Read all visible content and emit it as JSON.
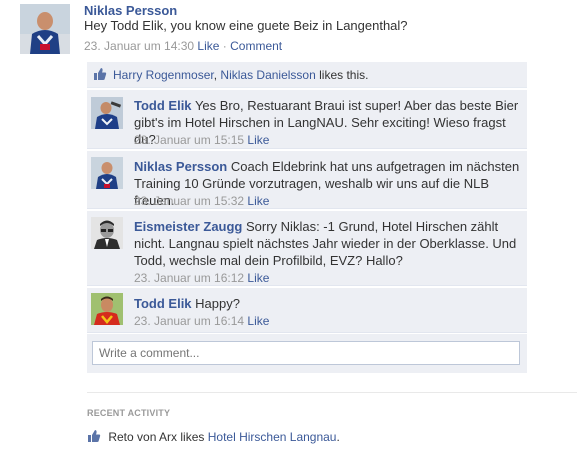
{
  "post": {
    "author": "Niklas Persson",
    "text": "Hey Todd Elik, you know eine guete Beiz in Langenthal?",
    "time": "23. Januar um 14:30",
    "like_label": "Like",
    "separator": "·",
    "comment_label": "Comment"
  },
  "likes": {
    "name1": "Harry Rogenmoser",
    "comma": ",",
    "name2": "Niklas Danielsson",
    "suffix": "likes this."
  },
  "comments": [
    {
      "author": "Todd Elik",
      "text": "Yes Bro, Restuarant Braui ist super! Aber das beste Bier gibt's im Hotel Hirschen in LangNAU. Sehr exciting! Wieso fragst du?",
      "time": "23. Januar um 15:15",
      "like": "Like"
    },
    {
      "author": "Niklas Persson",
      "text": "Coach Eldebrink hat uns aufgetragen im nächsten Training 10 Gründe vorzutragen, weshalb wir uns auf die NLB freuen.",
      "time": "23. Januar um 15:32",
      "like": "Like"
    },
    {
      "author": "Eismeister Zaugg",
      "text": "Sorry Niklas: -1 Grund, Hotel Hirschen zählt nicht. Langnau spielt nächstes Jahr wieder in der Oberklasse. Und Todd, wechsle mal dein Profilbild, EVZ? Hallo?",
      "time": "23. Januar um 16:12",
      "like": "Like"
    },
    {
      "author": "Todd Elik",
      "text": "Happy?",
      "time": "23. Januar um 16:14",
      "like": "Like"
    }
  ],
  "comment_input": {
    "placeholder": "Write a comment..."
  },
  "recent": {
    "title": "RECENT ACTIVITY",
    "actor": "Reto von Arx likes",
    "page": "Hotel Hirschen Langnau",
    "period": "."
  },
  "colors": {
    "link": "#3b5998",
    "panel": "#edeff4",
    "muted": "#999999"
  }
}
